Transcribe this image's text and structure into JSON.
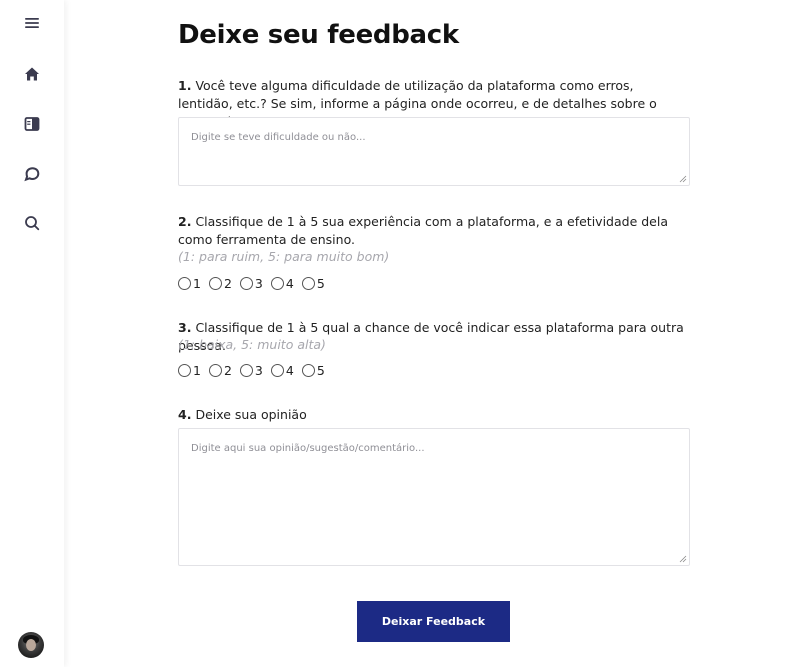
{
  "sidebar": {
    "items": [
      {
        "icon": "menu-icon"
      },
      {
        "icon": "home-icon"
      },
      {
        "icon": "book-icon"
      },
      {
        "icon": "chat-icon"
      },
      {
        "icon": "search-icon"
      }
    ],
    "avatar": {
      "icon": "user-avatar"
    }
  },
  "page": {
    "title": "Deixe seu feedback"
  },
  "questions": {
    "q1": {
      "number": "1.",
      "text": "Você teve alguma dificuldade de utilização da plataforma como erros, lentidão, etc.? Se sim, informe a página onde ocorreu, e de detalhes sobre o acontecimento.",
      "placeholder": "Digite se teve dificuldade ou não...",
      "value": ""
    },
    "q2": {
      "number": "2.",
      "text": "Classifique de 1 à 5 sua experiência com a plataforma, e a efetividade dela como ferramenta de ensino.",
      "hint": "(1: para ruim, 5: para muito bom)",
      "options": [
        "1",
        "2",
        "3",
        "4",
        "5"
      ],
      "selected": null
    },
    "q3": {
      "number": "3.",
      "text": "Classifique de 1 à 5 qual a chance de você indicar essa plataforma para outra pessoa.",
      "hint": "(1: baixa, 5: muito alta)",
      "options": [
        "1",
        "2",
        "3",
        "4",
        "5"
      ],
      "selected": null
    },
    "q4": {
      "number": "4.",
      "text": "Deixe sua opinião",
      "placeholder": "Digite aqui sua opinião/sugestão/comentário...",
      "value": ""
    }
  },
  "submit": {
    "label": "Deixar Feedback"
  },
  "colors": {
    "button_bg": "#1c2a85",
    "icon": "#3b3b4f",
    "hint": "#a7a7ad"
  }
}
